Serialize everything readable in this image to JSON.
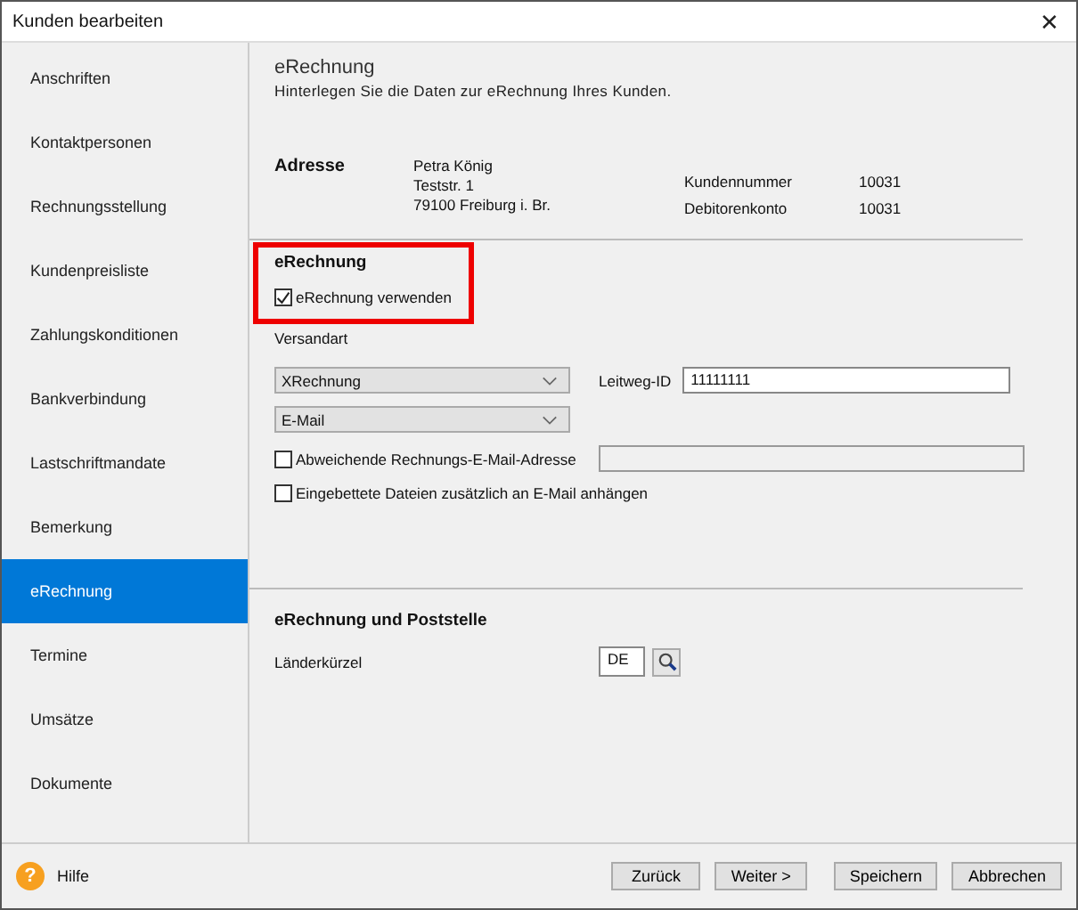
{
  "window": {
    "title": "Kunden bearbeiten",
    "close": "✕"
  },
  "sidebar": {
    "items": [
      {
        "label": "Anschriften",
        "selected": false
      },
      {
        "label": "Kontaktpersonen",
        "selected": false
      },
      {
        "label": "Rechnungsstellung",
        "selected": false
      },
      {
        "label": "Kundenpreisliste",
        "selected": false
      },
      {
        "label": "Zahlungskonditionen",
        "selected": false
      },
      {
        "label": "Bankverbindung",
        "selected": false
      },
      {
        "label": "Lastschriftmandate",
        "selected": false
      },
      {
        "label": "Bemerkung",
        "selected": false
      },
      {
        "label": "eRechnung",
        "selected": true
      },
      {
        "label": "Termine",
        "selected": false
      },
      {
        "label": "Umsätze",
        "selected": false
      },
      {
        "label": "Dokumente",
        "selected": false
      }
    ]
  },
  "header": {
    "title": "eRechnung",
    "subtitle": "Hinterlegen Sie die Daten zur eRechnung Ihres Kunden."
  },
  "address": {
    "label": "Adresse",
    "lines": [
      "Petra König",
      "Teststr.  1",
      "79100 Freiburg i. Br."
    ],
    "fields": [
      {
        "label": "Kundennummer",
        "value": "10031"
      },
      {
        "label": "Debitorenkonto",
        "value": "10031"
      }
    ]
  },
  "erechnung": {
    "title": "eRechnung",
    "highlighted": true,
    "use": {
      "label": "eRechnung verwenden",
      "checked": true
    },
    "versandart_label": "Versandart",
    "format": "XRechnung",
    "channel": "E-Mail",
    "leitweg_label": "Leitweg-ID",
    "leitweg_value": "11111111",
    "alt_email": {
      "label": "Abweichende Rechnungs-E-Mail-Adresse",
      "checked": false
    },
    "attach": {
      "label": "Eingebettete Dateien zusätzlich an E-Mail anhängen",
      "checked": false
    }
  },
  "poststelle": {
    "title": "eRechnung und Poststelle",
    "country_label": "Länderkürzel",
    "country_value": "DE"
  },
  "footer": {
    "help": "Hilfe",
    "help_icon": "?",
    "buttons": [
      "Zurück",
      "Weiter >",
      "Speichern",
      "Abbrechen"
    ]
  }
}
